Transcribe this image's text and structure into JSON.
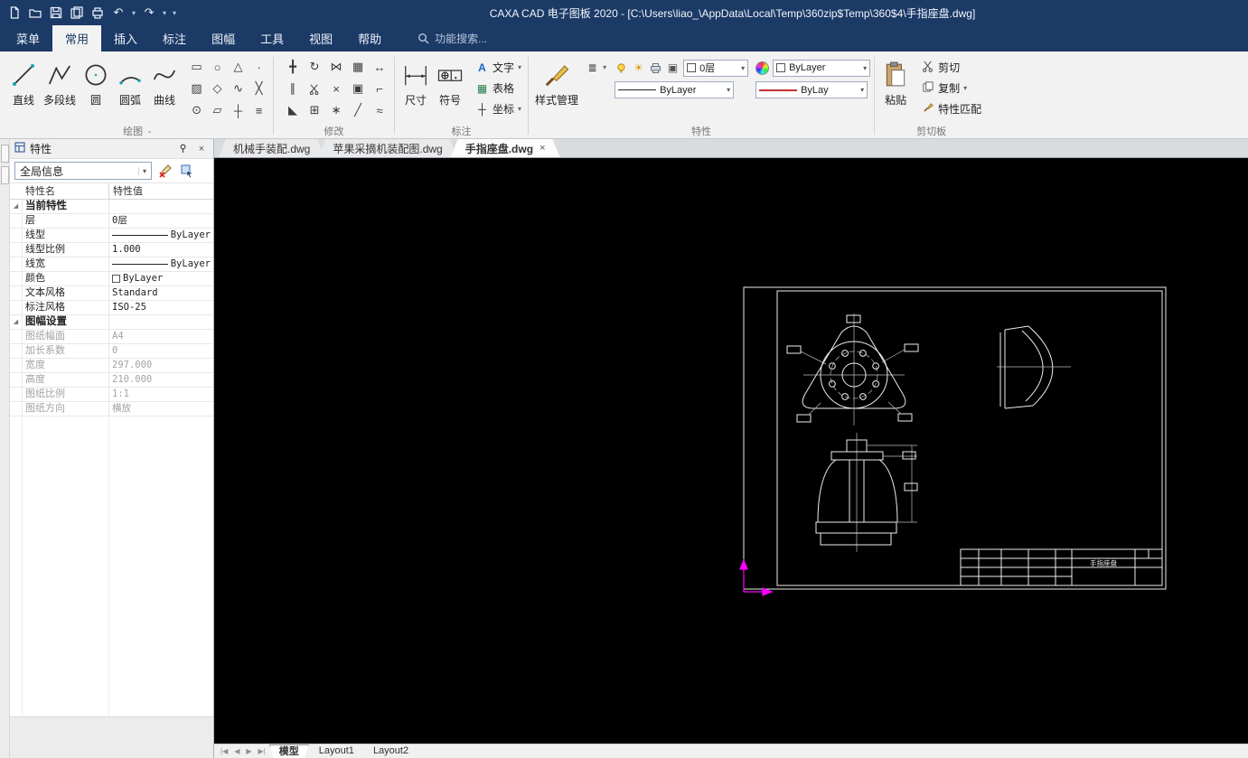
{
  "colors": {
    "titlebar": "#1b3a66",
    "canvas": "#000000",
    "axis": "#ff00ff",
    "cad_line": "#ececec"
  },
  "window": {
    "title": "CAXA CAD 电子图板 2020 - [C:\\Users\\liao_\\AppData\\Local\\Temp\\360zip$Temp\\360$4\\手指座盘.dwg]"
  },
  "menu": {
    "tabs": [
      {
        "label": "菜单"
      },
      {
        "label": "常用"
      },
      {
        "label": "插入"
      },
      {
        "label": "标注"
      },
      {
        "label": "图幅"
      },
      {
        "label": "工具"
      },
      {
        "label": "视图"
      },
      {
        "label": "帮助"
      }
    ],
    "search": "功能搜索..."
  },
  "ribbon": {
    "draw": {
      "label": "绘图",
      "line": "直线",
      "polyline": "多段线",
      "circle": "圆",
      "arc": "圆弧",
      "curve": "曲线"
    },
    "modify": {
      "label": "修改"
    },
    "annotate": {
      "label": "标注",
      "dimension": "尺寸",
      "symbol": "符号",
      "text": "文字",
      "table": "表格",
      "coordinate": "坐标"
    },
    "properties": {
      "label": "特性",
      "style_manager": "样式管理",
      "layer": "0层",
      "color": "ByLayer",
      "linetype": "ByLayer",
      "lineweight": "ByLay"
    },
    "clipboard": {
      "label": "剪切板",
      "paste": "粘贴",
      "cut": "剪切",
      "copy": "复制",
      "match": "特性匹配"
    }
  },
  "doc_tabs": [
    {
      "label": "机械手装配.dwg"
    },
    {
      "label": "苹果采摘机装配图.dwg"
    },
    {
      "label": "手指座盘.dwg"
    }
  ],
  "panel": {
    "title": "特性",
    "scope": "全局信息",
    "columns": {
      "name": "特性名",
      "value": "特性值"
    },
    "rows": [
      {
        "name": "当前特性",
        "value": ""
      },
      {
        "name": "层",
        "value": "0层"
      },
      {
        "name": "线型",
        "value": "ByLayer"
      },
      {
        "name": "线型比例",
        "value": "1.000"
      },
      {
        "name": "线宽",
        "value": "ByLayer"
      },
      {
        "name": "颜色",
        "value": "ByLayer"
      },
      {
        "name": "文本风格",
        "value": "Standard"
      },
      {
        "name": "标注风格",
        "value": "ISO-25"
      },
      {
        "name": "图幅设置",
        "value": ""
      },
      {
        "name": "图纸幅面",
        "value": "A4"
      },
      {
        "name": "加长系数",
        "value": "0"
      },
      {
        "name": "宽度",
        "value": "297.000"
      },
      {
        "name": "高度",
        "value": "210.000"
      },
      {
        "name": "图纸比例",
        "value": "1:1"
      },
      {
        "name": "图纸方向",
        "value": "横放"
      }
    ]
  },
  "drawing": {
    "title_block_text": "手指座盘"
  },
  "layout": {
    "tabs": [
      {
        "label": "模型"
      },
      {
        "label": "Layout1"
      },
      {
        "label": "Layout2"
      }
    ]
  }
}
